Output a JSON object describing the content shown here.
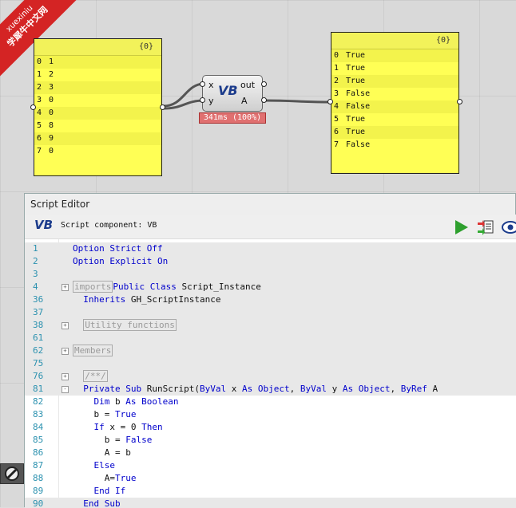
{
  "watermark": {
    "line1": "xuexiniu",
    "line2": "学犀牛中文网"
  },
  "left_panel": {
    "header": "{0}",
    "rows": [
      {
        "idx": "0",
        "val": "1"
      },
      {
        "idx": "1",
        "val": "2"
      },
      {
        "idx": "2",
        "val": "3"
      },
      {
        "idx": "3",
        "val": "0"
      },
      {
        "idx": "4",
        "val": "0"
      },
      {
        "idx": "5",
        "val": "8"
      },
      {
        "idx": "6",
        "val": "9"
      },
      {
        "idx": "7",
        "val": "0"
      }
    ]
  },
  "vb_component": {
    "input_x": "x",
    "input_y": "y",
    "output_out": "out",
    "output_a": "A",
    "logo": "VB",
    "timing": "341ms (100%)"
  },
  "right_panel": {
    "header": "{0}",
    "rows": [
      {
        "idx": "0",
        "val": "True"
      },
      {
        "idx": "1",
        "val": "True"
      },
      {
        "idx": "2",
        "val": "True"
      },
      {
        "idx": "3",
        "val": "False"
      },
      {
        "idx": "4",
        "val": "False"
      },
      {
        "idx": "5",
        "val": "True"
      },
      {
        "idx": "6",
        "val": "True"
      },
      {
        "idx": "7",
        "val": "False"
      }
    ]
  },
  "editor": {
    "title": "Script Editor",
    "logo": "VB",
    "component_label": "Script component: VB",
    "lines": [
      {
        "n": "1",
        "text": "Option Strict Off"
      },
      {
        "n": "2",
        "text": "Option Explicit On"
      },
      {
        "n": "3",
        "text": ""
      },
      {
        "n": "4",
        "text": "Public Class Script_Instance",
        "collapsed": "imports"
      },
      {
        "n": "36",
        "text": "  Inherits GH_ScriptInstance"
      },
      {
        "n": "37",
        "text": ""
      },
      {
        "n": "38",
        "text": "",
        "collapsed": "Utility functions"
      },
      {
        "n": "61",
        "text": ""
      },
      {
        "n": "62",
        "text": "",
        "collapsed": "Members"
      },
      {
        "n": "75",
        "text": ""
      },
      {
        "n": "76",
        "text": "",
        "collapsed": "/**/"
      },
      {
        "n": "81",
        "text": "  Private Sub RunScript(ByVal x As Object, ByVal y As Object, ByRef A"
      },
      {
        "n": "82",
        "text": "    Dim b As Boolean"
      },
      {
        "n": "83",
        "text": "    b = True"
      },
      {
        "n": "84",
        "text": "    If x = 0 Then"
      },
      {
        "n": "85",
        "text": "      b = False"
      },
      {
        "n": "86",
        "text": "      A = b"
      },
      {
        "n": "87",
        "text": "    Else"
      },
      {
        "n": "88",
        "text": "      A=True"
      },
      {
        "n": "89",
        "text": "    End If"
      },
      {
        "n": "90",
        "text": "  End Sub"
      }
    ]
  },
  "colors": {
    "panel": "#ffff55",
    "keyword": "#0000cc",
    "line_number": "#2b91af",
    "run_button": "#2ea02e",
    "timing_bar": "#e07070"
  },
  "icons": [
    "run-icon",
    "parameters-icon",
    "preview-icon",
    "settings-icon"
  ]
}
